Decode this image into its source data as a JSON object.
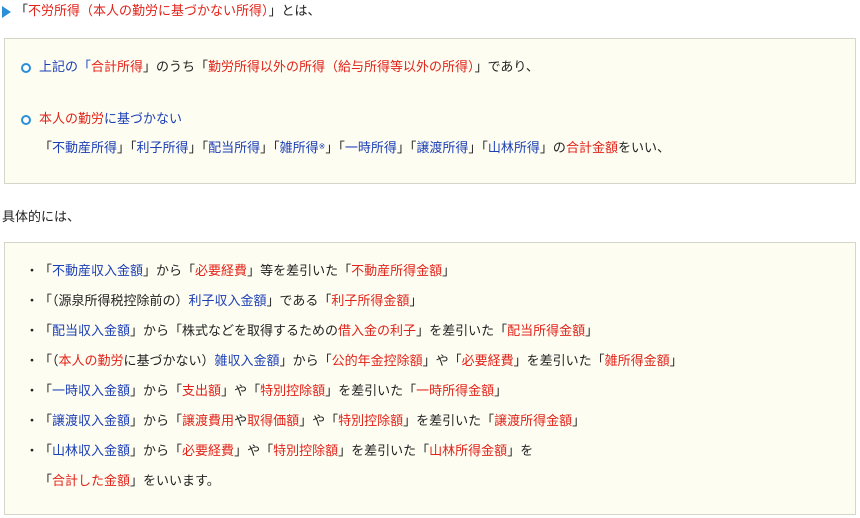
{
  "heading": {
    "arrow_icon": "triangle-right-icon",
    "open": "「",
    "term": "不労所得（本人の勤労に基づかない所得）",
    "close": "」とは、"
  },
  "definition_box": {
    "item1": {
      "p1": "上記の「",
      "p2": "合計所得",
      "p3": "」のうち「",
      "p4": "勤労所得以外の所得（給与所得等以外の所得）",
      "p5": "」であり、"
    },
    "item2": {
      "line1_red": "本人の勤労",
      "line1_blue": "に基づかない",
      "q1": "「",
      "t1": "不動産所得",
      "q2": "」「",
      "t2": "利子所得",
      "q3": "」「",
      "t3": "配当所得",
      "q4": "」「",
      "t4": "雑所得",
      "t4_mark": "※",
      "q5": "」「",
      "t5": "一時所得",
      "q6": "」「",
      "t6": "譲渡所得",
      "q7": "」「",
      "t7": "山林所得",
      "q8": "」の",
      "t8": "合計金額",
      "q9": "をいい、"
    }
  },
  "concretely_label": "具体的には、",
  "detail_box": {
    "bullet": "・",
    "r1": {
      "a": "「",
      "b": "不動産収入金額",
      "c": "」から「",
      "d": "必要経費",
      "e": "」等を差引いた「",
      "f": "不動産所得金額",
      "g": "」"
    },
    "r2": {
      "a": "「（源泉所得税控除前の）",
      "b": "利子収入金額",
      "c": "」である「",
      "d": "利子所得金額",
      "e": "」"
    },
    "r3": {
      "a": "「",
      "b": "配当収入金額",
      "c": "」から「株式などを取得するための",
      "d": "借入金の利子",
      "e": "」を差引いた「",
      "f": "配当所得金額",
      "g": "」"
    },
    "r4": {
      "a": "「（",
      "b": "本人の勤労",
      "c": "に基づかない）",
      "d": "雑収入金額",
      "e": "」から「",
      "f": "公的年金控除額",
      "g": "」や「",
      "h": "必要経費",
      "i": "」を差引いた「",
      "j": "雑所得金額",
      "k": "」"
    },
    "r5": {
      "a": "「",
      "b": "一時収入金額",
      "c": "」から「",
      "d": "支出額",
      "e": "」や「",
      "f": "特別控除額",
      "g": "」を差引いた「",
      "h": "一時所得金額",
      "i": "」"
    },
    "r6": {
      "a": "「",
      "b": "譲渡収入金額",
      "c": "」から「",
      "d": "譲渡費用",
      "e": "や",
      "f": "取得価額",
      "g": "」や「",
      "h": "特別控除額",
      "i": "」を差引いた「",
      "j": "譲渡所得金額",
      "k": "」"
    },
    "r7": {
      "a": "「",
      "b": "山林収入金額",
      "c": "」から「",
      "d": "必要経費",
      "e": "」や「",
      "f": "特別控除額",
      "g": "」を差引いた「",
      "h": "山林所得金額",
      "i": "」を"
    },
    "r8": {
      "a": "「",
      "b": "合計した金額",
      "c": "」をいいます。"
    }
  },
  "colors": {
    "red": "#e2231a",
    "blue": "#1d3fb5",
    "accent": "#2a8fd6",
    "box_bg": "#fdfdf2"
  }
}
